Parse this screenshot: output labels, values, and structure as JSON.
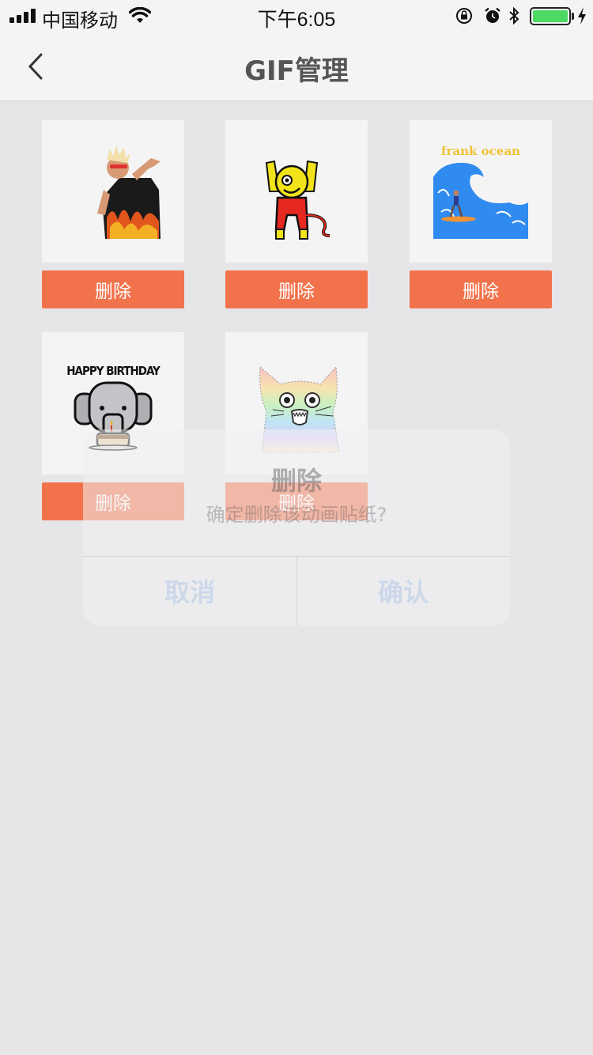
{
  "status_bar": {
    "carrier": "中国移动",
    "time": "下午6:05",
    "battery_level": 1.0,
    "battery_color": "#4cd964"
  },
  "nav": {
    "title": "GIF管理",
    "back_icon": "chevron-left-icon"
  },
  "stickers": [
    {
      "image": "man-flame-shirt-gif",
      "delete_label": "删除"
    },
    {
      "image": "red-devil-rock-gif",
      "delete_label": "删除"
    },
    {
      "image": "frank-ocean-wave-gif",
      "image_text": "frank ocean",
      "delete_label": "删除"
    },
    {
      "image": "elephant-birthday-gif",
      "image_text": "HAPPY BIRTHDAY",
      "delete_label": "删除"
    },
    {
      "image": "rainbow-cat-gif",
      "delete_label": "删除"
    }
  ],
  "dialog": {
    "title": "删除",
    "message": "确定删除该动画贴纸?",
    "cancel_label": "取消",
    "confirm_label": "确认"
  },
  "colors": {
    "delete_button": "#f2724c",
    "background": "#e6e6e8"
  }
}
